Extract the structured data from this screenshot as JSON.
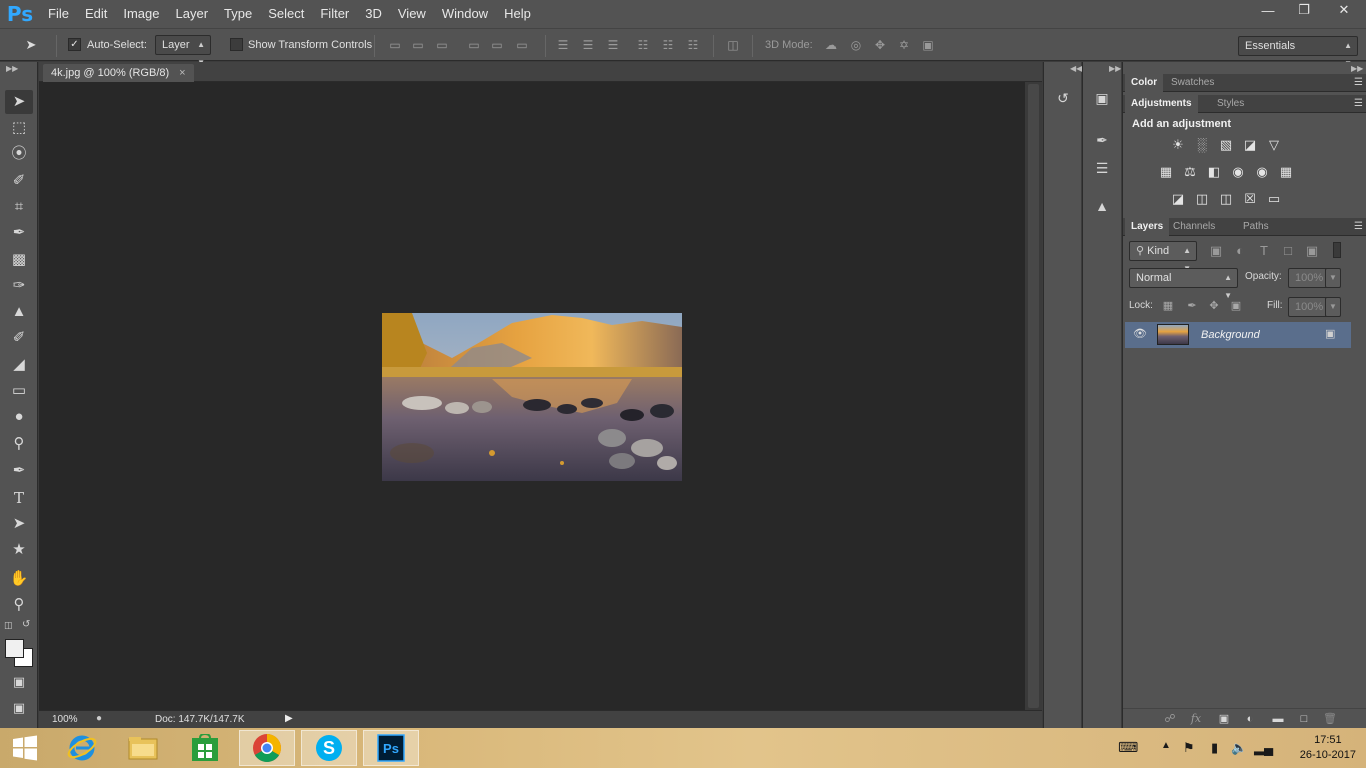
{
  "app": {
    "logo": "Ps"
  },
  "menu": [
    "File",
    "Edit",
    "Image",
    "Layer",
    "Type",
    "Select",
    "Filter",
    "3D",
    "View",
    "Window",
    "Help"
  ],
  "window_controls": {
    "minimize": "minimize-icon",
    "restore": "restore-icon",
    "close": "close-icon"
  },
  "options_bar": {
    "auto_select_label": "Auto-Select:",
    "auto_select_checked": true,
    "auto_select_value": "Layer",
    "transform_label": "Show Transform Controls",
    "transform_checked": false,
    "mode_3d_label": "3D Mode:",
    "workspace": "Essentials"
  },
  "document": {
    "tab_title": "4k.jpg @ 100% (RGB/8)",
    "zoom": "100%",
    "doc_size": "Doc: 147.7K/147.7K"
  },
  "panels": {
    "top_tabs": [
      "Color",
      "Swatches"
    ],
    "adj_tabs": [
      "Adjustments",
      "Styles"
    ],
    "adj_heading": "Add an adjustment",
    "layer_tabs": [
      "Layers",
      "Channels",
      "Paths"
    ],
    "kind_label": "Kind",
    "blend_mode": "Normal",
    "opacity_label": "Opacity:",
    "opacity_value": "100%",
    "lock_label": "Lock:",
    "fill_label": "Fill:",
    "fill_value": "100%",
    "layer_name": "Background"
  },
  "taskbar": {
    "apps": [
      "windows-start-icon",
      "internet-explorer-icon",
      "file-explorer-icon",
      "store-icon",
      "chrome-icon",
      "skype-icon",
      "photoshop-icon"
    ],
    "time": "17:51",
    "date": "26-10-2017"
  },
  "colors": {
    "ui_bg": "#535353",
    "canvas_bg": "#282828",
    "ps_blue": "#31a8ff",
    "layer_selected": "#5a6e8c"
  }
}
